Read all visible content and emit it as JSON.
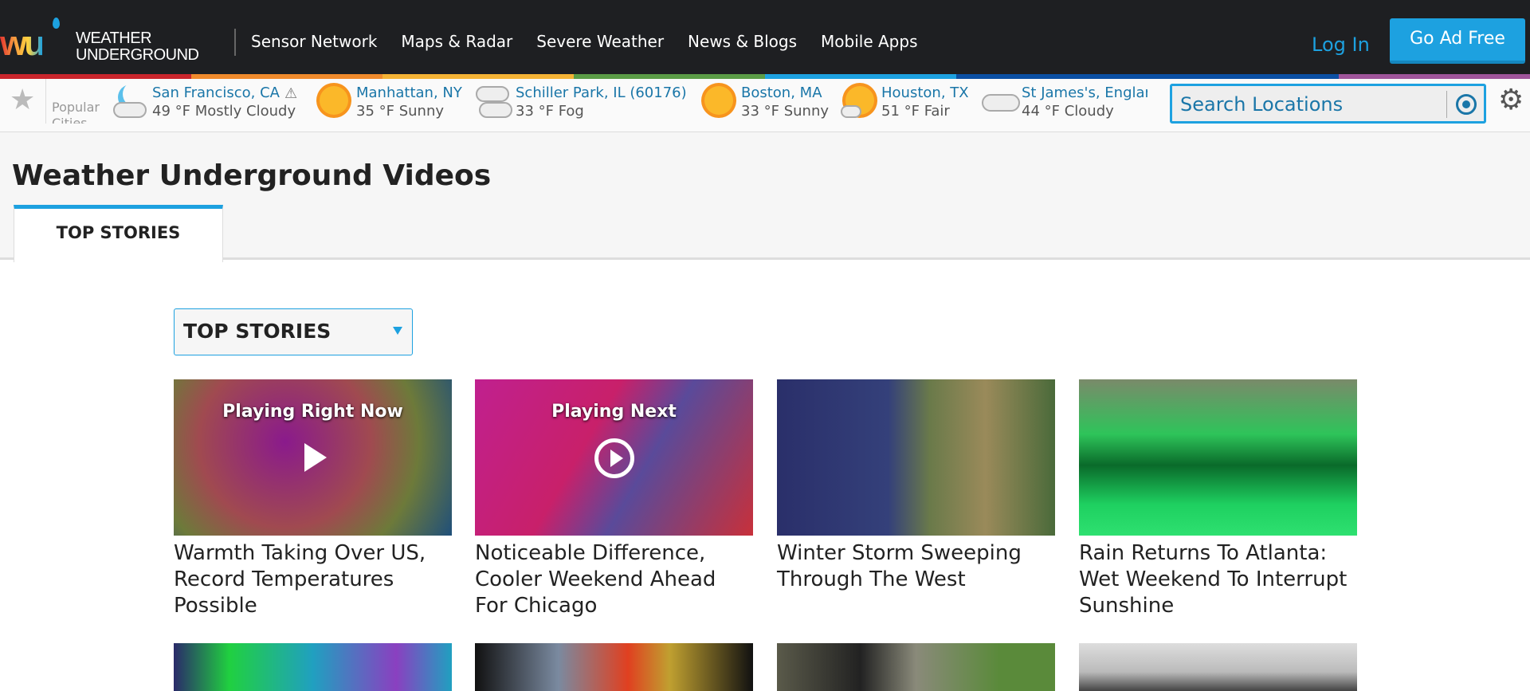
{
  "header": {
    "logo_text": "WEATHER UNDERGROUND",
    "nav": [
      "Sensor Network",
      "Maps & Radar",
      "Severe Weather",
      "News & Blogs",
      "Mobile Apps"
    ],
    "login": "Log In",
    "ad_free": "Go Ad Free"
  },
  "stripe_colors": [
    "#c9252c",
    "#f08a2c",
    "#f5b335",
    "#5b9c46",
    "#1da1e0",
    "#0b4fa3",
    "#0b4fa3",
    "#a0559b"
  ],
  "cities": {
    "label": "Popular Cities",
    "items": [
      {
        "name": "San Francisco, CA",
        "cond": "49 °F Mostly Cloudy",
        "icon": "moon-cloud-icon"
      },
      {
        "name": "Manhattan, NY",
        "cond": "35 °F Sunny",
        "icon": "sun-icon"
      },
      {
        "name": "Schiller Park, IL (60176)",
        "cond": "33 °F Fog",
        "icon": "fog-icon"
      },
      {
        "name": "Boston, MA",
        "cond": "33 °F Sunny",
        "icon": "sun-icon"
      },
      {
        "name": "Houston, TX",
        "cond": "51 °F Fair",
        "icon": "sun-cloud-icon"
      },
      {
        "name": "St James's, England",
        "cond": "44 °F Cloudy",
        "icon": "cloud-icon"
      }
    ]
  },
  "search": {
    "placeholder": "Search Locations"
  },
  "page": {
    "title": "Weather Underground Videos",
    "tab": "TOP STORIES",
    "dropdown": "TOP STORIES"
  },
  "videos": [
    {
      "title": "Warmth Taking Over US, Record Temperatures Possible",
      "overlay": "Playing Right Now"
    },
    {
      "title": "Noticeable Difference, Cooler Weekend Ahead For Chicago",
      "overlay": "Playing Next"
    },
    {
      "title": "Winter Storm Sweeping Through The West"
    },
    {
      "title": "Rain Returns To Atlanta: Wet Weekend To Interrupt Sunshine"
    }
  ]
}
